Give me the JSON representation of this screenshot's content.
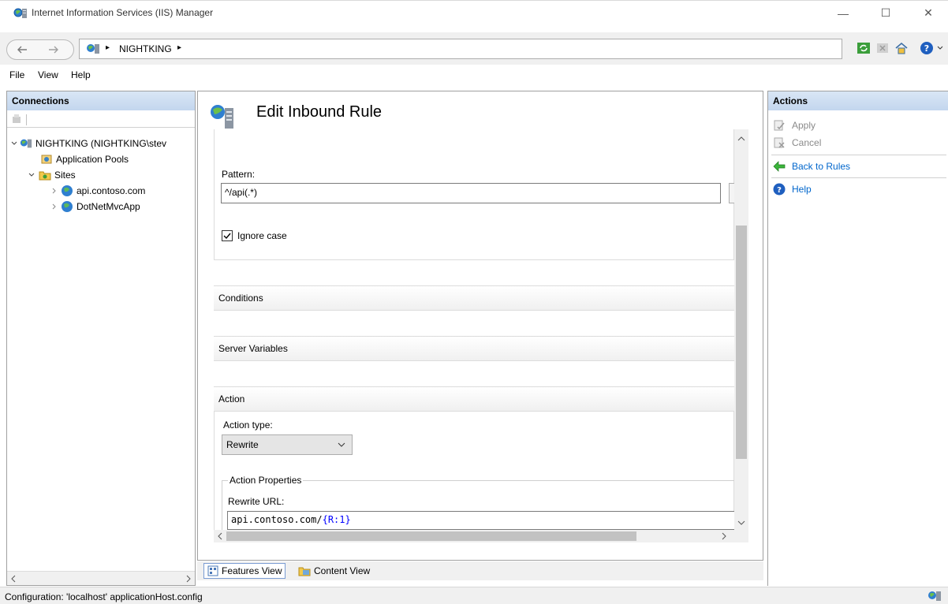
{
  "window": {
    "title": "Internet Information Services (IIS) Manager",
    "min_glyph": "—",
    "max_glyph": "☐",
    "close_glyph": "✕"
  },
  "address": {
    "path": "NIGHTKING",
    "separator": "▸"
  },
  "menu": {
    "file": "File",
    "view": "View",
    "help": "Help"
  },
  "connections": {
    "header": "Connections",
    "tree": {
      "server": "NIGHTKING (NIGHTKING\\stev",
      "app_pools": "Application Pools",
      "sites": "Sites",
      "site1": "api.contoso.com",
      "site2": "DotNetMvcApp"
    }
  },
  "main": {
    "title": "Edit Inbound Rule",
    "pattern_label": "Pattern:",
    "pattern_value": "^/api(.*)",
    "ignore_case_label": "Ignore case",
    "conditions_label": "Conditions",
    "server_variables_label": "Server Variables",
    "action_label": "Action",
    "action_type_label": "Action type:",
    "action_type_value": "Rewrite",
    "action_properties_label": "Action Properties",
    "rewrite_url_label": "Rewrite URL:",
    "rewrite_url_plain": "api.contoso.com/",
    "rewrite_url_var": "{R:1}"
  },
  "view_tabs": {
    "features": "Features View",
    "content": "Content View"
  },
  "actions": {
    "header": "Actions",
    "apply": "Apply",
    "cancel": "Cancel",
    "back_to_rules": "Back to Rules",
    "help": "Help"
  },
  "status": {
    "text": "Configuration: 'localhost' applicationHost.config"
  },
  "colors": {
    "link": "#0066cc",
    "disabled": "#8a8a8a",
    "header_bg": "#c3d6ee",
    "var_blue": "#0000ff"
  }
}
